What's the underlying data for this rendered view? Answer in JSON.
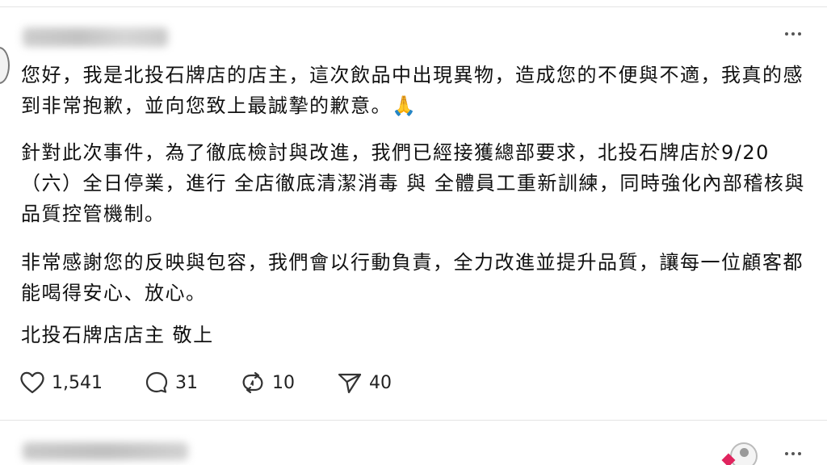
{
  "post": {
    "paragraphs": [
      "您好，我是北投石牌店的店主，這次飲品中出現異物，造成您的不便與不適，我真的感到非常抱歉，並向您致上最誠摯的歉意。🙏",
      "針對此次事件，為了徹底檢討與改進，我們已經接獲總部要求，北投石牌店於9/20（六）全日停業，進行 全店徹底清潔消毒 與 全體員工重新訓練，同時強化內部稽核與品質控管機制。",
      "非常感謝您的反映與包容，我們會以行動負責，全力改進並提升品質，讓每一位顧客都能喝得安心、放心。"
    ],
    "signature": "北投石牌店店主 敬上"
  },
  "actions": {
    "likes": "1,541",
    "comments": "31",
    "reposts": "10",
    "shares": "40"
  },
  "icons": {
    "like": "heart-icon",
    "comment": "comment-bubble-icon",
    "repost": "repost-icon",
    "share": "send-icon",
    "more": "more-dots-icon"
  },
  "colors": {
    "text": "#111111",
    "divider": "#e4e4e4",
    "icon": "#333333"
  }
}
